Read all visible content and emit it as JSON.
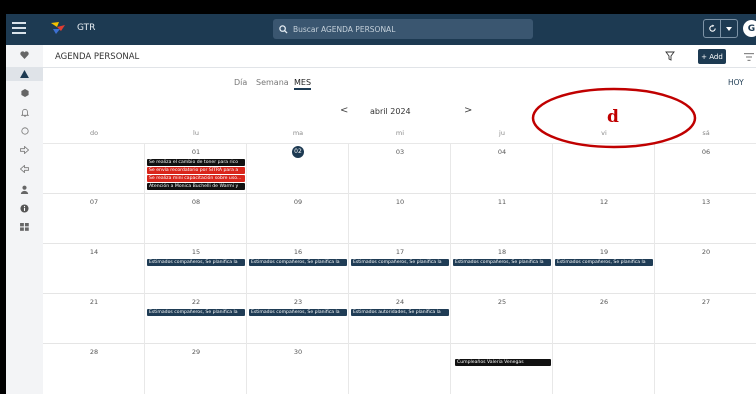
{
  "topbar": {
    "app_name": "GTR",
    "search_placeholder": "Buscar AGENDA PERSONAL",
    "avatar_initial": "G",
    "background": "#1d3a52"
  },
  "sidebar": {
    "icons": [
      "heart-icon",
      "triangle-icon",
      "hexagon-icon",
      "bell-icon",
      "circle-icon",
      "arrow-right-outline-icon",
      "arrow-left-outline-icon",
      "user-icon",
      "info-icon",
      "grid-icon"
    ]
  },
  "header": {
    "title": "AGENDA PERSONAL",
    "add_label": "+ Add"
  },
  "views": {
    "dia": "Día",
    "semana": "Semana",
    "mes": "MES",
    "active": "MES",
    "hoy": "HOY"
  },
  "calendar": {
    "month_label": "abril 2024",
    "prev": "<",
    "next": ">",
    "weekdays": [
      "do",
      "lu",
      "ma",
      "mi",
      "ju",
      "vi",
      "sá"
    ],
    "today": "02",
    "weeks": [
      [
        "",
        "01",
        "02",
        "03",
        "04",
        "",
        "06"
      ],
      [
        "07",
        "08",
        "09",
        "10",
        "11",
        "12",
        "13"
      ],
      [
        "14",
        "15",
        "16",
        "17",
        "18",
        "19",
        "20"
      ],
      [
        "21",
        "22",
        "23",
        "24",
        "25",
        "26",
        "27"
      ],
      [
        "28",
        "29",
        "30",
        "",
        "",
        "",
        ""
      ]
    ],
    "events": [
      {
        "text": "Se realiza el cambio de toner para rico",
        "color": "#111111"
      },
      {
        "text": "Se envía recordatorio por SITRA para a",
        "color": "#d9261c"
      },
      {
        "text": "Se realiza mini capacitación sobre uso...",
        "color": "#d9261c"
      },
      {
        "text": "Atención a Monica Buchelli de Warmi y",
        "color": "#111111"
      },
      {
        "text": "Estimados compañeros, Se planifica la",
        "color": "#1f3c55"
      },
      {
        "text": "Estimados compañeros, Se planifica la",
        "color": "#1f3c55"
      },
      {
        "text": "Estimados compañeros, Se planifica la",
        "color": "#1f3c55"
      },
      {
        "text": "Estimados compañeros, Se planifica la",
        "color": "#1f3c55"
      },
      {
        "text": "Estimados compañeros, Se planifica la",
        "color": "#1f3c55"
      },
      {
        "text": "Estimados compañeros, Se planifica la",
        "color": "#1f3c55"
      },
      {
        "text": "Estimados compañeros, Se planifica la",
        "color": "#1f3c55"
      },
      {
        "text": "Estimados autoridades, Se planifica la",
        "color": "#1f3c55"
      },
      {
        "text": "Cumpleaños Valeria Venegas",
        "color": "#111111"
      }
    ]
  },
  "annotation": {
    "letter": "d",
    "color": "#c00000"
  }
}
